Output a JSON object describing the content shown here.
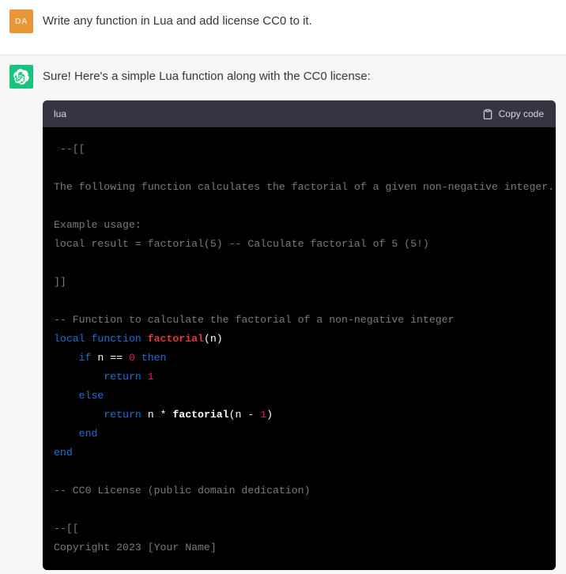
{
  "conversation": {
    "messages": [
      {
        "role": "user",
        "avatar_initials": "DA",
        "avatar_color": "#e9963b",
        "text": "Write any function in Lua and add license CC0 to it."
      },
      {
        "role": "assistant",
        "avatar_icon": "openai-logo-icon",
        "avatar_color": "#19c37d",
        "text": "Sure! Here's a simple Lua function along with the CC0 license:"
      }
    ]
  },
  "code_block": {
    "language_label": "lua",
    "copy_label": "Copy code",
    "copy_icon": "clipboard-icon",
    "background": "#000000",
    "header_background": "#343541",
    "colors": {
      "comment": "#7a7a7a",
      "keyword": "#1f6fd0",
      "function": "#dd3a3a",
      "number": "#d91f5c",
      "plain": "#ffffff"
    },
    "lines": [
      [
        {
          "t": " --[[",
          "c": "cmt"
        }
      ],
      [
        {
          "t": "",
          "c": "cmt"
        }
      ],
      [
        {
          "t": "The following function calculates the factorial of a given non-negative integer.",
          "c": "cmt"
        }
      ],
      [
        {
          "t": "",
          "c": "cmt"
        }
      ],
      [
        {
          "t": "Example usage:",
          "c": "cmt"
        }
      ],
      [
        {
          "t": "local result = factorial(5) -- Calculate factorial of 5 (5!)",
          "c": "cmt"
        }
      ],
      [
        {
          "t": "",
          "c": "cmt"
        }
      ],
      [
        {
          "t": "]]",
          "c": "cmt"
        }
      ],
      [
        {
          "t": "",
          "c": "cmt"
        }
      ],
      [
        {
          "t": "-- Function to calculate the factorial of a non-negative integer",
          "c": "cmt"
        }
      ],
      [
        {
          "t": "local",
          "c": "kw"
        },
        {
          "t": " ",
          "c": "pln"
        },
        {
          "t": "function",
          "c": "kw"
        },
        {
          "t": " ",
          "c": "pln"
        },
        {
          "t": "factorial",
          "c": "fn"
        },
        {
          "t": "(n)",
          "c": "pln"
        }
      ],
      [
        {
          "t": "    ",
          "c": "pln"
        },
        {
          "t": "if",
          "c": "kw"
        },
        {
          "t": " n == ",
          "c": "pln"
        },
        {
          "t": "0",
          "c": "num"
        },
        {
          "t": " ",
          "c": "pln"
        },
        {
          "t": "then",
          "c": "kw"
        }
      ],
      [
        {
          "t": "        ",
          "c": "pln"
        },
        {
          "t": "return",
          "c": "kw"
        },
        {
          "t": " ",
          "c": "pln"
        },
        {
          "t": "1",
          "c": "num"
        }
      ],
      [
        {
          "t": "    ",
          "c": "pln"
        },
        {
          "t": "else",
          "c": "kw"
        }
      ],
      [
        {
          "t": "        ",
          "c": "pln"
        },
        {
          "t": "return",
          "c": "kw"
        },
        {
          "t": " n * ",
          "c": "pln"
        },
        {
          "t": "factorial",
          "c": "fnw"
        },
        {
          "t": "(n - ",
          "c": "pln"
        },
        {
          "t": "1",
          "c": "num"
        },
        {
          "t": ")",
          "c": "pln"
        }
      ],
      [
        {
          "t": "    ",
          "c": "pln"
        },
        {
          "t": "end",
          "c": "kw"
        }
      ],
      [
        {
          "t": "end",
          "c": "kw"
        }
      ],
      [
        {
          "t": "",
          "c": "cmt"
        }
      ],
      [
        {
          "t": "-- CC0 License (public domain dedication)",
          "c": "cmt"
        }
      ],
      [
        {
          "t": "",
          "c": "cmt"
        }
      ],
      [
        {
          "t": "--[[",
          "c": "cmt"
        }
      ],
      [
        {
          "t": "Copyright 2023 [Your Name]",
          "c": "cmt"
        }
      ]
    ]
  }
}
